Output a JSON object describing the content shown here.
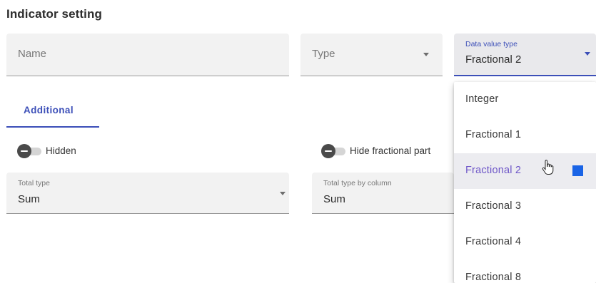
{
  "page": {
    "title": "Indicator setting"
  },
  "fields": {
    "name": {
      "placeholder": "Name"
    },
    "type": {
      "placeholder": "Type"
    },
    "data_value_type": {
      "label": "Data value type",
      "value": "Fractional 2"
    },
    "total_type": {
      "label": "Total type",
      "value": "Sum"
    },
    "total_type_by_column": {
      "label": "Total type by column",
      "value": "Sum"
    }
  },
  "tabs": [
    {
      "label": "Additional",
      "active": true
    }
  ],
  "toggles": {
    "hidden": {
      "label": "Hidden",
      "on": false
    },
    "hide_fractional_part": {
      "label": "Hide fractional part",
      "on": false
    }
  },
  "dropdown": {
    "options": [
      {
        "label": "Integer"
      },
      {
        "label": "Fractional 1"
      },
      {
        "label": "Fractional 2",
        "selected": true
      },
      {
        "label": "Fractional 3"
      },
      {
        "label": "Fractional 4"
      },
      {
        "label": "Fractional 8"
      }
    ]
  },
  "colors": {
    "accent": "#3c4fb8",
    "selected_text": "#6e56c8",
    "selected_marker": "#1a64e6"
  },
  "icons": {
    "select_caret": "chevron-down-icon",
    "pointer": "hand-pointer-icon"
  }
}
